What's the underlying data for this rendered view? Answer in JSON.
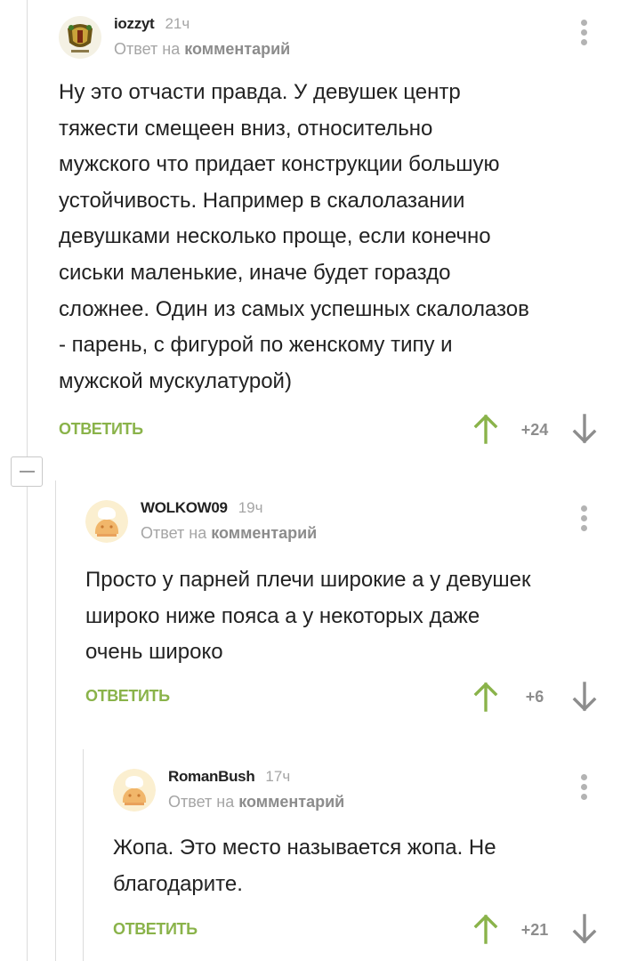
{
  "comments": [
    {
      "author": "iozzyt",
      "time": "21ч",
      "reply_prefix": "Ответ на",
      "reply_link": "комментарий",
      "text_lines": [
        "Ну это отчасти правда. У девушек центр",
        "тяжести смещеен вниз, относительно",
        "мужского что придает конструкции большую",
        "устойчивость. Например в скалолазании",
        "девушками несколько проще, если конечно",
        "сиськи маленькие, иначе будет гораздо",
        "сложнее. Один из самых успешных скалолазов",
        "- парень, с фигурой по женскому типу и",
        "мужской мускулатурой)"
      ],
      "reply_label": "ОТВЕТИТЬ",
      "score": "+24"
    },
    {
      "author": "WOLKOW09",
      "time": "19ч",
      "reply_prefix": "Ответ на",
      "reply_link": "комментарий",
      "text_lines": [
        "Просто у парней плечи широкие а у девушек",
        "широко ниже пояса а у некоторых даже",
        "очень широко"
      ],
      "reply_label": "ОТВЕТИТЬ",
      "score": "+6"
    },
    {
      "author": "RomanBush",
      "time": "17ч",
      "reply_prefix": "Ответ на",
      "reply_link": "комментарий",
      "text_lines": [
        "Жопа. Это место называется жопа. Не",
        "благодарите."
      ],
      "reply_label": "ОТВЕТИТЬ",
      "score": "+21"
    }
  ],
  "colors": {
    "accent_green": "#8ab34a",
    "muted_text": "#a5a5a5",
    "thread_line": "#dcdcdc"
  },
  "icons": [
    "crest-avatar-icon",
    "default-avatar-icon",
    "more-dots-icon",
    "arrow-up-icon",
    "arrow-down-icon",
    "collapse-minus-icon"
  ]
}
